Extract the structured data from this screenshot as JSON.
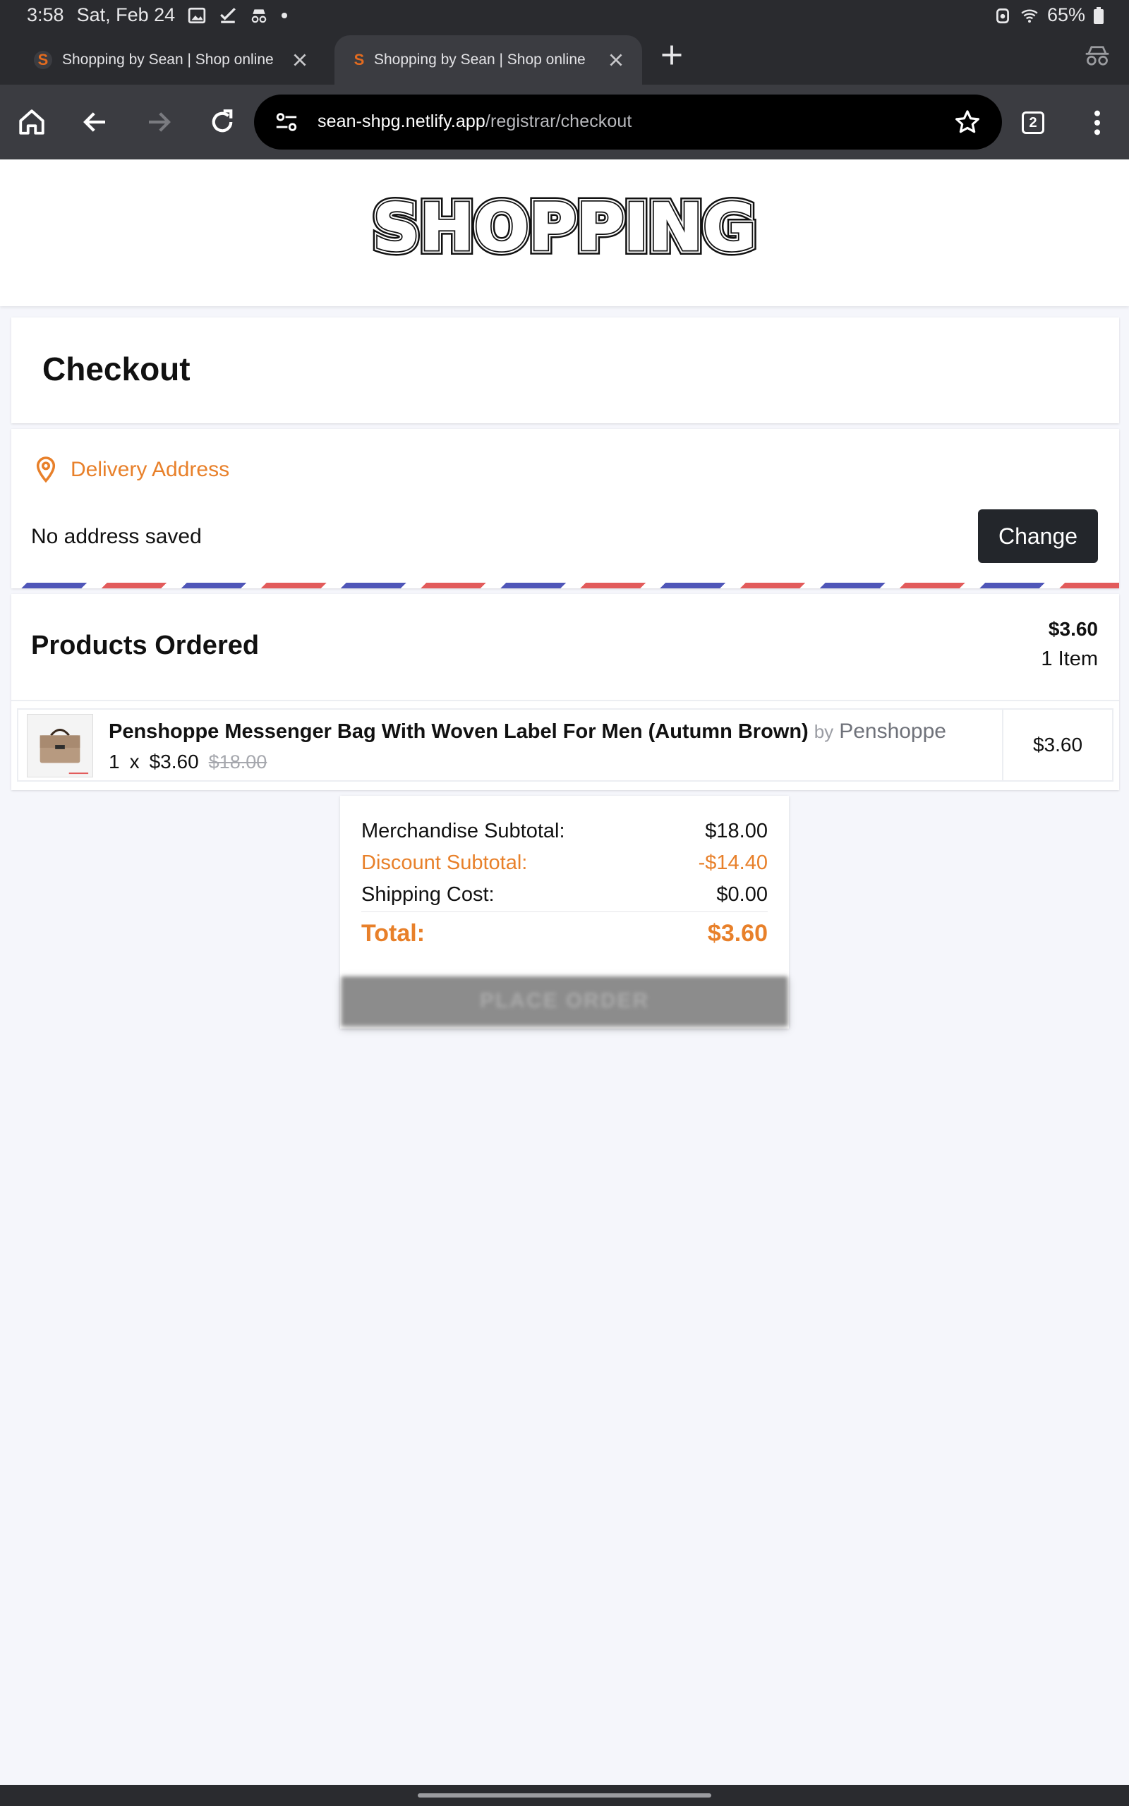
{
  "status_bar": {
    "time": "3:58",
    "date": "Sat, Feb 24",
    "battery": "65%",
    "left_icons": [
      "image-icon",
      "check-icon",
      "incognito-icon",
      "dot-icon"
    ],
    "right_icons": [
      "alarm-icon",
      "wifi-icon",
      "battery-icon"
    ]
  },
  "tabs": [
    {
      "title": "Shopping by Sean | Shop online",
      "favicon": "S"
    },
    {
      "title": "Shopping by Sean | Shop online",
      "favicon": "S"
    }
  ],
  "toolbar": {
    "url_host": "sean-shpg.netlify.app",
    "url_path": "/registrar/checkout",
    "tab_count": "2"
  },
  "site": {
    "logo_text": "SHOPPING"
  },
  "checkout": {
    "title": "Checkout"
  },
  "delivery": {
    "heading": "Delivery Address",
    "address_text": "No address saved",
    "change_label": "Change"
  },
  "products": {
    "heading": "Products Ordered",
    "total": "$3.60",
    "item_count": "1 Item",
    "items": [
      {
        "name": "Penshoppe Messenger Bag With Woven Label For Men (Autumn Brown)",
        "by": "by",
        "brand": "Penshoppe",
        "qty": "1",
        "times": "x",
        "price": "$3.60",
        "original_price": "$18.00",
        "line_total": "$3.60"
      }
    ]
  },
  "summary": {
    "merch_label": "Merchandise Subtotal:",
    "merch_value": "$18.00",
    "discount_label": "Discount Subtotal:",
    "discount_value": "-$14.40",
    "shipping_label": "Shipping Cost:",
    "shipping_value": "$0.00",
    "total_label": "Total:",
    "total_value": "$3.60",
    "place_order_label": "PLACE ORDER"
  },
  "colors": {
    "accent": "#e8802a",
    "browser_chrome": "#3b3c41",
    "status_bar": "#2a2b2f",
    "button_dark": "#23262b",
    "airmail_red": "#e25b5b",
    "airmail_blue": "#4f56b8"
  }
}
